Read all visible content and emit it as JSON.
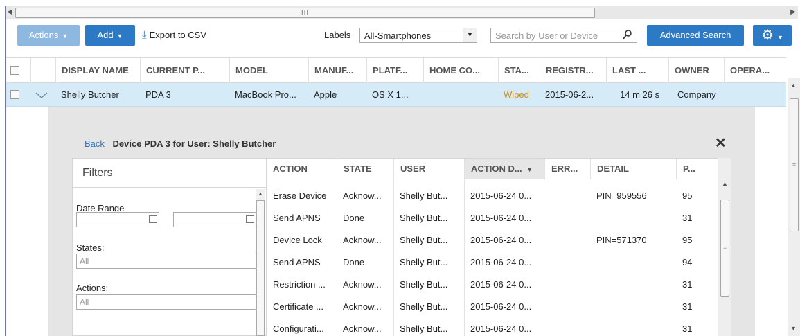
{
  "toolbar": {
    "actions_label": "Actions",
    "add_label": "Add",
    "export_label": "Export to CSV",
    "labels_label": "Labels",
    "labels_value": "All-Smartphones",
    "search_placeholder": "Search by User or Device",
    "advanced_search_label": "Advanced Search"
  },
  "grid": {
    "columns": [
      "DISPLAY NAME",
      "CURRENT P...",
      "MODEL",
      "MANUF...",
      "PLATF...",
      "HOME CO...",
      "STA...",
      "REGISTR...",
      "LAST ...",
      "OWNER",
      "OPERA..."
    ],
    "row": {
      "display_name": "Shelly Butcher",
      "current_p": "PDA 3",
      "model": "MacBook Pro...",
      "manuf": "Apple",
      "platform": "OS X 1...",
      "home_co": "",
      "status": "Wiped",
      "registered": "2015-06-2...",
      "last": "14 m 26 s",
      "owner": "Company",
      "opera": ""
    }
  },
  "detail": {
    "back_label": "Back",
    "title": "Device PDA 3 for User: Shelly Butcher",
    "filters": {
      "header": "Filters",
      "date_range_label": "Date Range",
      "states_label": "States:",
      "states_value": "All",
      "actions_label": "Actions:",
      "actions_value": "All"
    },
    "actions_table": {
      "columns": [
        "ACTION",
        "STATE",
        "USER",
        "ACTION D...",
        "ERR...",
        "DETAIL",
        "P..."
      ],
      "rows": [
        {
          "action": "Erase Device",
          "state": "Acknow...",
          "user": "Shelly But...",
          "date": "2015-06-24 0...",
          "err": "",
          "detail": "PIN=959556",
          "p": "95"
        },
        {
          "action": "Send APNS",
          "state": "Done",
          "user": "Shelly But...",
          "date": "2015-06-24 0...",
          "err": "",
          "detail": "",
          "p": "31"
        },
        {
          "action": "Device Lock",
          "state": "Acknow...",
          "user": "Shelly But...",
          "date": "2015-06-24 0...",
          "err": "",
          "detail": "PIN=571370",
          "p": "95"
        },
        {
          "action": "Send APNS",
          "state": "Done",
          "user": "Shelly But...",
          "date": "2015-06-24 0...",
          "err": "",
          "detail": "",
          "p": "94"
        },
        {
          "action": "Restriction ...",
          "state": "Acknow...",
          "user": "Shelly But...",
          "date": "2015-06-24 0...",
          "err": "",
          "detail": "",
          "p": "31"
        },
        {
          "action": "Certificate ...",
          "state": "Acknow...",
          "user": "Shelly But...",
          "date": "2015-06-24 0...",
          "err": "",
          "detail": "",
          "p": "31"
        },
        {
          "action": "Configurati...",
          "state": "Acknow...",
          "user": "Shelly But...",
          "date": "2015-06-24 0...",
          "err": "",
          "detail": "",
          "p": "31"
        }
      ]
    }
  },
  "colors": {
    "primary": "#2c7ac5",
    "primary_light": "#8fb8e0",
    "selected_row": "#d6ebf8",
    "wiped": "#d08a20",
    "panel_gray": "#e5e5e5"
  },
  "icons": {
    "export": "download-icon",
    "search": "search-icon",
    "settings": "gear-icon",
    "close": "close-icon",
    "calendar": "calendar-icon"
  }
}
